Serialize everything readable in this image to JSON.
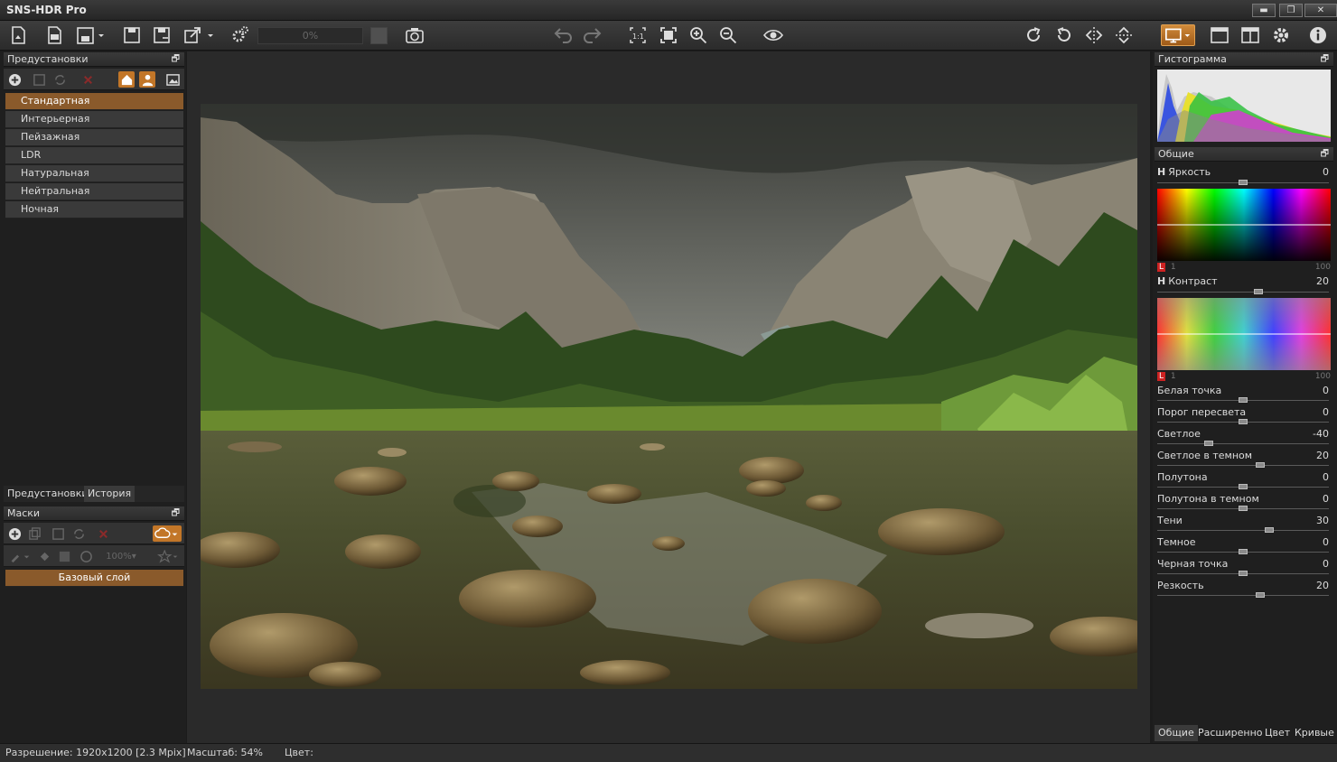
{
  "app": {
    "title": "SNS-HDR Pro"
  },
  "window_buttons": {
    "minimize": "▬",
    "maximize": "❐",
    "close": "✕"
  },
  "toolbar": {
    "progress_text": "0%"
  },
  "presets_panel": {
    "title": "Предустановки",
    "items": [
      {
        "label": "Стандартная"
      },
      {
        "label": "Интерьерная"
      },
      {
        "label": "Пейзажная"
      },
      {
        "label": "LDR"
      },
      {
        "label": "Натуральная"
      },
      {
        "label": "Нейтральная"
      },
      {
        "label": "Ночная"
      }
    ],
    "tabs": [
      "Предустановки",
      "История"
    ]
  },
  "masks_panel": {
    "title": "Маски",
    "opacity_text": "100%",
    "base_layer": "Базовый слой"
  },
  "histogram_panel": {
    "title": "Гистограмма"
  },
  "general_panel": {
    "title": "Общие",
    "brightness": {
      "label": "Яркость",
      "value": "0"
    },
    "contrast": {
      "label": "Контраст",
      "value": "20"
    },
    "curve_left": "L",
    "curve_min": "1",
    "curve_max": "100",
    "sliders": [
      {
        "label": "Белая точка",
        "value": "0",
        "level": 0.5
      },
      {
        "label": "Порог пересвета",
        "value": "0",
        "level": 0.5
      },
      {
        "label": "Светлое",
        "value": "-40",
        "level": 0.3
      },
      {
        "label": "Светлое в темном",
        "value": "20",
        "level": 0.6
      },
      {
        "label": "Полутона",
        "value": "0",
        "level": 0.5
      },
      {
        "label": "Полутона в темном",
        "value": "0",
        "level": 0.5
      },
      {
        "label": "Тени",
        "value": "30",
        "level": 0.65
      },
      {
        "label": "Темное",
        "value": "0",
        "level": 0.5
      },
      {
        "label": "Черная точка",
        "value": "0",
        "level": 0.5
      },
      {
        "label": "Резкость",
        "value": "20",
        "level": 0.6
      }
    ],
    "bottom_tabs": [
      "Общие",
      "Расширенно",
      "Цвет",
      "Кривые"
    ]
  },
  "status": {
    "resolution": "Разрешение: 1920x1200 [2.3 Mpix]",
    "zoom": "Масштаб: 54%",
    "color": "Цвет:"
  },
  "colors": {
    "accent": "#c97d30",
    "selected": "#8a5a2b"
  }
}
